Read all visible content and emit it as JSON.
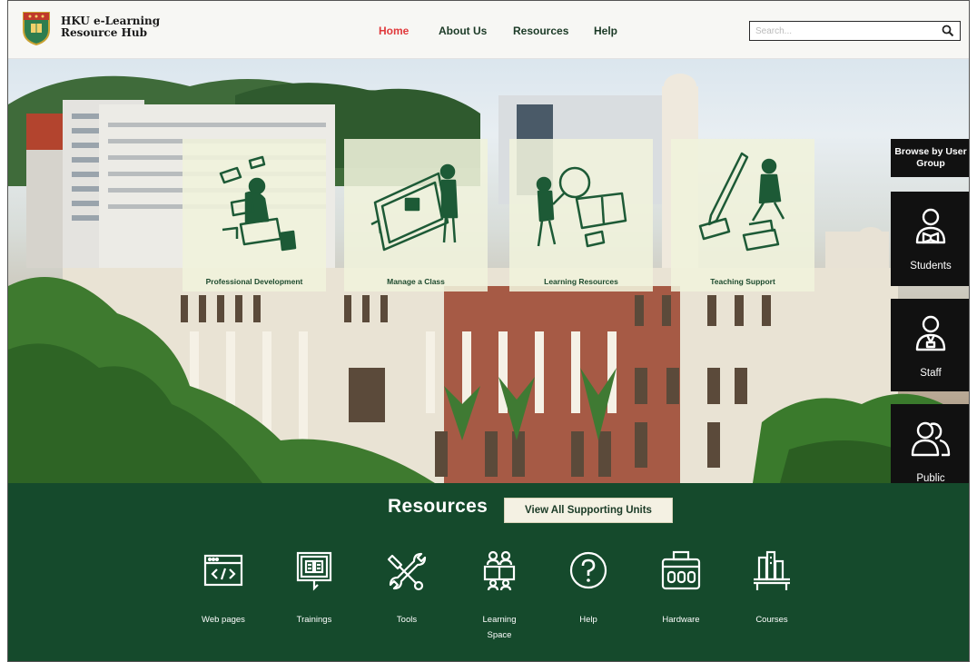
{
  "header": {
    "brand_line1": "HKU e-Learning",
    "brand_line2": "Resource Hub",
    "nav": [
      {
        "label": "Home",
        "active": true
      },
      {
        "label": "About Us"
      },
      {
        "label": "Resources"
      },
      {
        "label": "Help"
      }
    ],
    "search_placeholder": "Search..."
  },
  "hero": {
    "cards": [
      {
        "label": "Professional Development",
        "icon": "person-laptop-illustration"
      },
      {
        "label": "Manage a Class",
        "icon": "teacher-screen-illustration"
      },
      {
        "label": "Learning Resources",
        "icon": "magnifier-book-illustration"
      },
      {
        "label": "Teaching Support",
        "icon": "pen-runner-illustration"
      }
    ],
    "browse_title": "Browse by User Group",
    "groups": [
      {
        "label": "Students",
        "icon": "student-icon"
      },
      {
        "label": "Staff",
        "icon": "staff-icon"
      },
      {
        "label": "Public",
        "icon": "public-icon"
      }
    ]
  },
  "resources": {
    "title": "Resources",
    "view_all": "View All Supporting Units",
    "items": [
      {
        "label": "Web pages",
        "icon": "code-window-icon"
      },
      {
        "label": "Trainings",
        "icon": "training-board-icon"
      },
      {
        "label": "Tools",
        "icon": "tools-icon"
      },
      {
        "label": "Learning Space",
        "icon": "learning-space-icon"
      },
      {
        "label": "Help",
        "icon": "help-icon"
      },
      {
        "label": "Hardware",
        "icon": "hardware-icon"
      },
      {
        "label": "Courses",
        "icon": "courses-icon"
      }
    ]
  },
  "colors": {
    "accent_red": "#e0393b",
    "brand_green": "#154a2c",
    "card_bg": "#f0f2dc",
    "side_black": "#111111"
  }
}
